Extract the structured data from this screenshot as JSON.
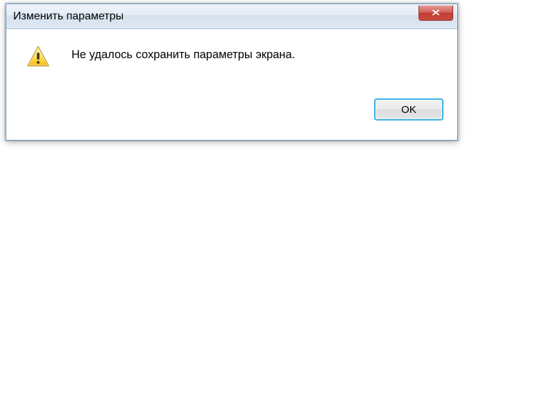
{
  "dialog": {
    "title": "Изменить параметры",
    "message": "Не удалось сохранить параметры экрана.",
    "ok_label": "OK"
  }
}
